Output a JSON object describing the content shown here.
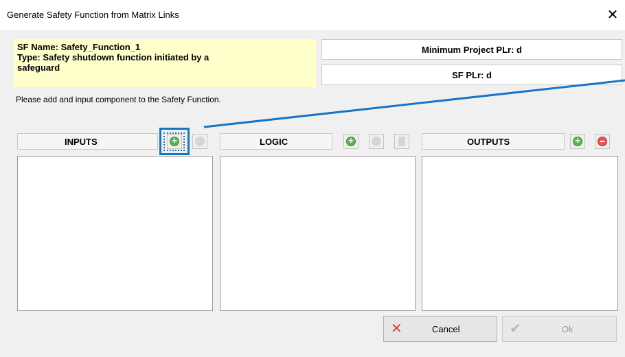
{
  "window": {
    "title": "Generate Safety Function from Matrix Links",
    "close_glyph": "✕"
  },
  "sf_info": {
    "name_line": "SF Name: Safety_Function_1",
    "type_line_1": "Type: Safety shutdown function initiated by a",
    "type_line_2": "safeguard"
  },
  "pl": {
    "minimum_project": "Minimum Project PLr: d",
    "sf": "SF PLr: d"
  },
  "instruction": "Please add and input component to the Safety Function.",
  "panels": {
    "inputs": {
      "label": "INPUTS",
      "buttons": [
        "add-icon",
        "disabled-icon"
      ]
    },
    "logic": {
      "label": "LOGIC",
      "buttons": [
        "add-icon",
        "disabled-icon",
        "disabled-square-icon"
      ]
    },
    "outputs": {
      "label": "OUTPUTS",
      "buttons": [
        "add-icon",
        "remove-icon"
      ]
    }
  },
  "buttons": {
    "cancel": {
      "label": "Cancel",
      "icon": "red-x-icon"
    },
    "ok": {
      "label": "Ok",
      "icon": "checkmark-icon",
      "enabled": false
    }
  },
  "colors": {
    "highlight": "#1674c7",
    "sf_info_bg": "#ffffcc",
    "add_green": "#59b54a",
    "remove_red": "#e5545a"
  }
}
